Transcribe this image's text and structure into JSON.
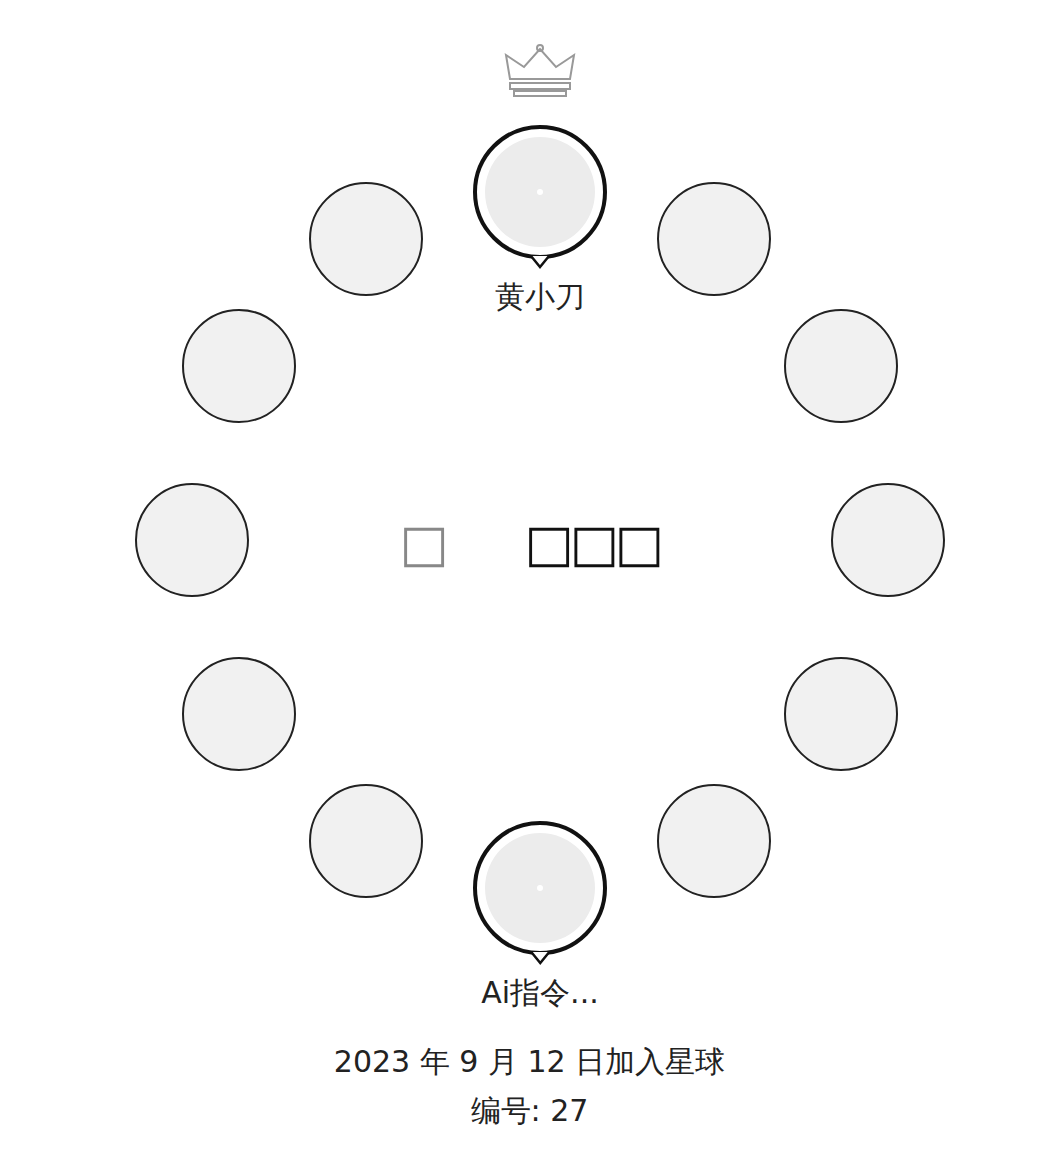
{
  "ring": [
    {
      "kind": "owner",
      "name": "黄小刀"
    },
    {
      "kind": "member"
    },
    {
      "kind": "member"
    },
    {
      "kind": "member"
    },
    {
      "kind": "member"
    },
    {
      "kind": "member"
    },
    {
      "kind": "self",
      "name": "Ai指令..."
    },
    {
      "kind": "member"
    },
    {
      "kind": "member"
    },
    {
      "kind": "member"
    },
    {
      "kind": "member"
    },
    {
      "kind": "member"
    }
  ],
  "center_marks": [
    "□",
    "□□□"
  ],
  "joined": "2023 年 9 月 12 日加入星球",
  "number": "编号: 27"
}
